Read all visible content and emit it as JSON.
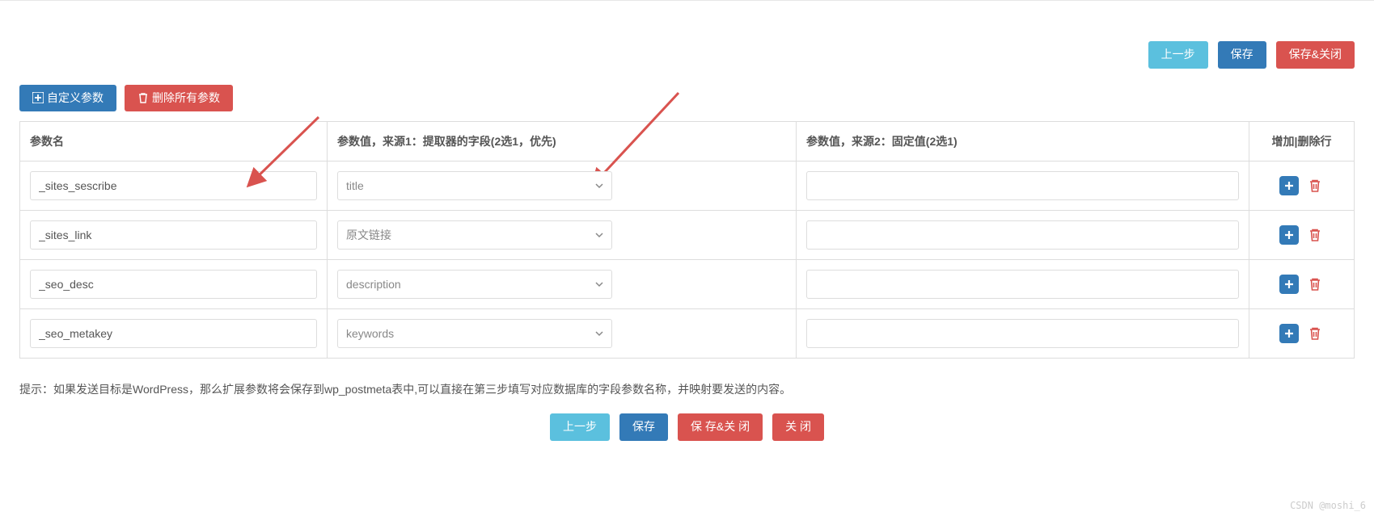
{
  "toolbar_top": {
    "prev": "上一步",
    "save": "保存",
    "save_close": "保存&关闭"
  },
  "secondary": {
    "add_custom": "自定义参数",
    "delete_all": "删除所有参数"
  },
  "table": {
    "headers": {
      "name": "参数名",
      "source1": "参数值，来源1：提取器的字段(2选1，优先)",
      "source2": "参数值，来源2：固定值(2选1)",
      "actions": "增加|删除行"
    },
    "rows": [
      {
        "name": "_sites_sescribe",
        "source1": "title",
        "source2": ""
      },
      {
        "name": "_sites_link",
        "source1": "原文链接",
        "source2": ""
      },
      {
        "name": "_seo_desc",
        "source1": "description",
        "source2": ""
      },
      {
        "name": "_seo_metakey",
        "source1": "keywords",
        "source2": ""
      }
    ]
  },
  "hint": "提示：如果发送目标是WordPress，那么扩展参数将会保存到wp_postmeta表中,可以直接在第三步填写对应数据库的字段参数名称，并映射要发送的内容。",
  "toolbar_bottom": {
    "prev": "上一步",
    "save": "保存",
    "save_close": "保 存&关 闭",
    "close": "关 闭"
  },
  "watermark": "CSDN @moshi_6"
}
